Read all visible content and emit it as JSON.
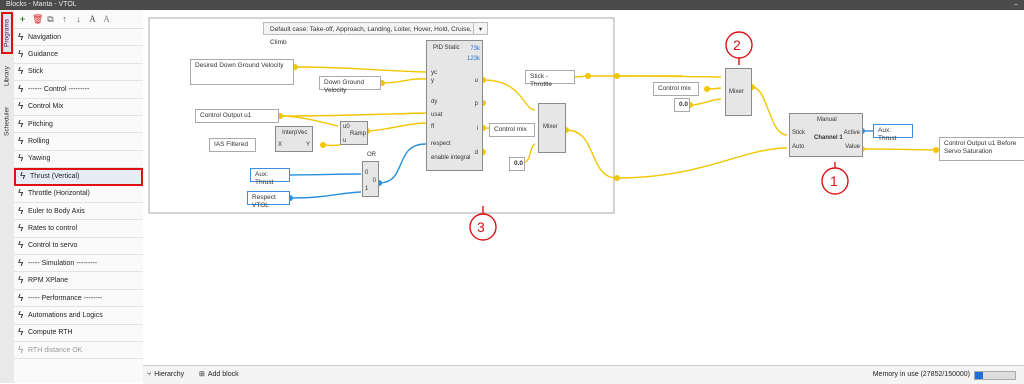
{
  "window": {
    "title": "Blocks - Manta - VTOL",
    "minimize": "–"
  },
  "side_tabs": {
    "programs": "Programs",
    "library": "Library",
    "scheduler": "Scheduler"
  },
  "toolbar": {
    "add": "+",
    "delete": "🗑",
    "copy": "⧉",
    "up": "↑",
    "down": "↓",
    "text": "A",
    "more": "A"
  },
  "sidebar": {
    "items": [
      {
        "label": "Navigation"
      },
      {
        "label": "Guidance"
      },
      {
        "label": "Stick"
      },
      {
        "label": "------ Control ---------"
      },
      {
        "label": "Control Mix"
      },
      {
        "label": "Pitching"
      },
      {
        "label": "Rolling"
      },
      {
        "label": "Yawing"
      },
      {
        "label": "Thrust (Vertical)"
      },
      {
        "label": "Throttle (Horizontal)"
      },
      {
        "label": "Euler to Body Axis"
      },
      {
        "label": "Rates to control"
      },
      {
        "label": "Control to servo"
      },
      {
        "label": "----- Simulation ---------"
      },
      {
        "label": "RPM XPlane"
      },
      {
        "label": "----- Performance --------"
      },
      {
        "label": "Automations and Logics"
      },
      {
        "label": "Compute RTH"
      },
      {
        "label": "RTH distance OK"
      }
    ]
  },
  "canvas": {
    "case_dropdown": "Default case: Take-off, Approach, Landing, Loiter, Hover, Hold, Cruise, Climb",
    "blocks": {
      "desired_down_ground_velocity": "Desired Down Ground Velocity",
      "down_ground_velocity": "Down Ground Velocity",
      "control_output_u1": "Control Output u1",
      "ias_filtered": "IAS Filtered",
      "interpvec": "InterpVec",
      "interpvec_x": "X",
      "interpvec_y": "Y",
      "ramp": "Ramp",
      "ramp_u0": "u0",
      "ramp_u": "u",
      "aux_thrust": "Aux: Thrust",
      "respect_vtol": "Respect VTOL",
      "or": "OR",
      "or_0": "0",
      "or_1": "1",
      "or_out": "0",
      "pid_title": "PID Static",
      "pid_val1": "73k",
      "pid_val2": "123k",
      "pid_yc": "yc",
      "pid_y": "y",
      "pid_dy": "dy",
      "pid_usat": "usat",
      "pid_ff": "ff",
      "pid_respect": "respect",
      "pid_enable": "enable integral",
      "pid_u": "u",
      "pid_p": "p",
      "pid_i": "i",
      "pid_d": "d",
      "control_mix_a": "Control mix",
      "mixer_a": "Mixer",
      "const_a": "0.0",
      "stick_throttle": "Stick - Throttle",
      "control_mix_b": "Control mix",
      "const_b": "0.0",
      "mixer_b": "Mixer",
      "manual_title": "Manual",
      "manual_channel": "Channel 1",
      "manual_stick": "Stick",
      "manual_auto": "Auto",
      "manual_active": "Active",
      "manual_value": "Value",
      "aux_thrust_out": "Aux: Thrust",
      "control_output_before": "Control Output u1 Before Servo Saturation"
    },
    "annotations": {
      "one": "1",
      "two": "2",
      "three": "3"
    }
  },
  "footer": {
    "hierarchy": "Hierarchy",
    "add_block": "Add block",
    "memory": "Memory in use (27852/150000)",
    "memory_fraction": 0.19
  }
}
